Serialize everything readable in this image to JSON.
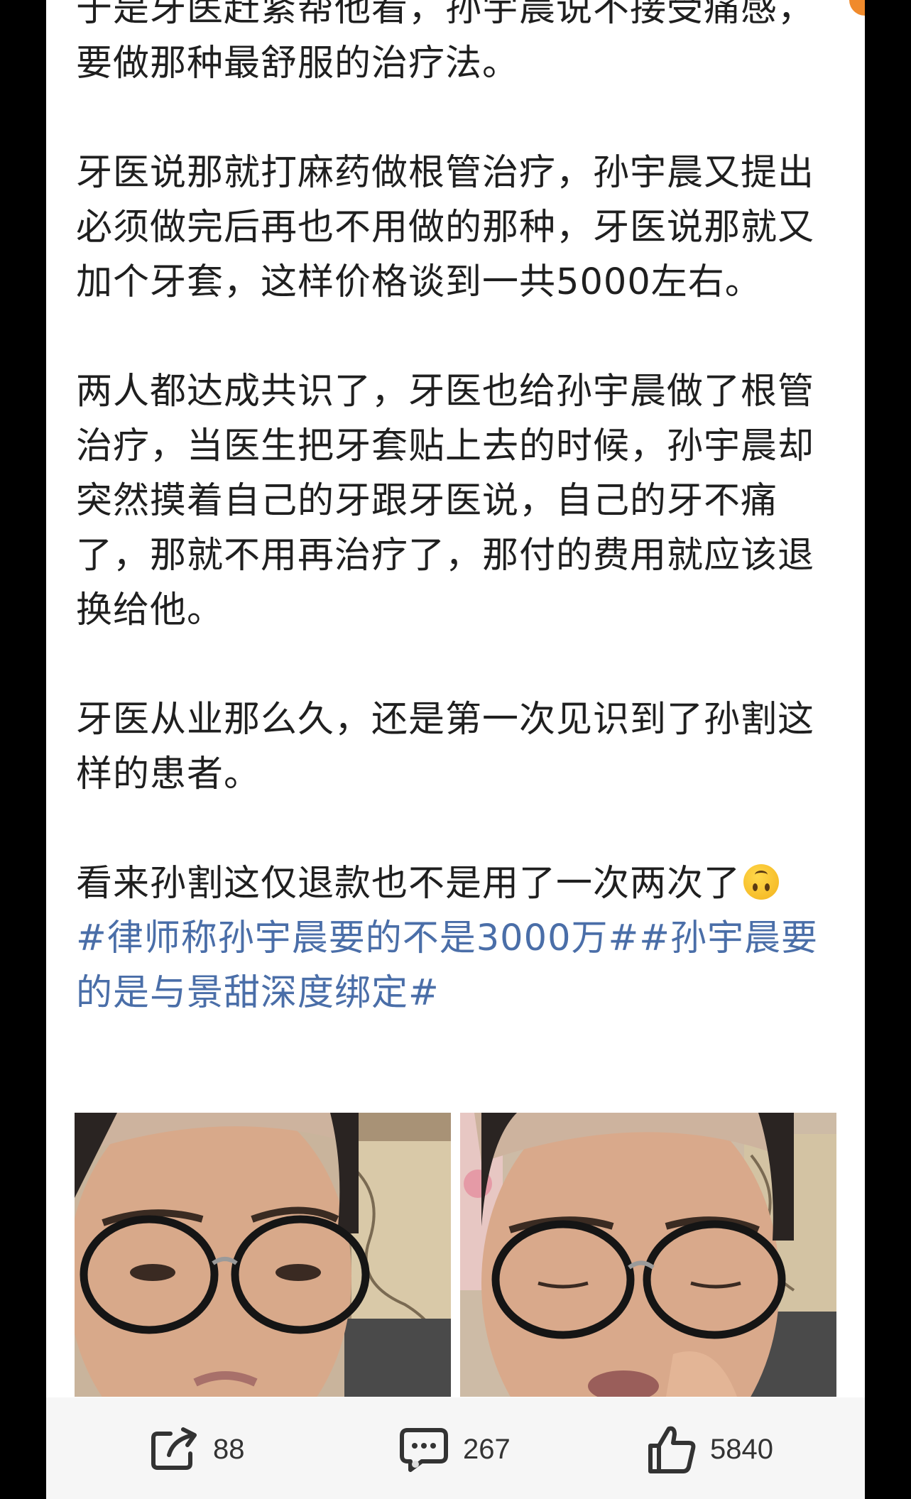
{
  "post": {
    "paragraphs": [
      "于是牙医赶紧帮他看，孙宇晨说不接受痛感，要做那种最舒服的治疗法。",
      "牙医说那就打麻药做根管治疗，孙宇晨又提出必须做完后再也不用做的那种，牙医说那就又加个牙套，这样价格谈到一共5000左右。",
      "两人都达成共识了，牙医也给孙宇晨做了根管治疗，当医生把牙套贴上去的时候，孙宇晨却突然摸着自己的牙跟牙医说，自己的牙不痛了，那就不用再治疗了，那付的费用就应该退换给他。",
      "牙医从业那么久，还是第一次见识到了孙割这样的患者。"
    ],
    "last_line": "看来孙割这仅退款也不是用了一次两次了",
    "emoji": "upside-down-face",
    "topics": "#律师称孙宇晨要的不是3000万##孙宇晨要的是与景甜深度绑定#"
  },
  "actions": {
    "share_count": "88",
    "comment_count": "267",
    "like_count": "5840"
  },
  "colors": {
    "topic": "#4a6ea8",
    "accent": "#f08a2c",
    "background": "#000000"
  }
}
